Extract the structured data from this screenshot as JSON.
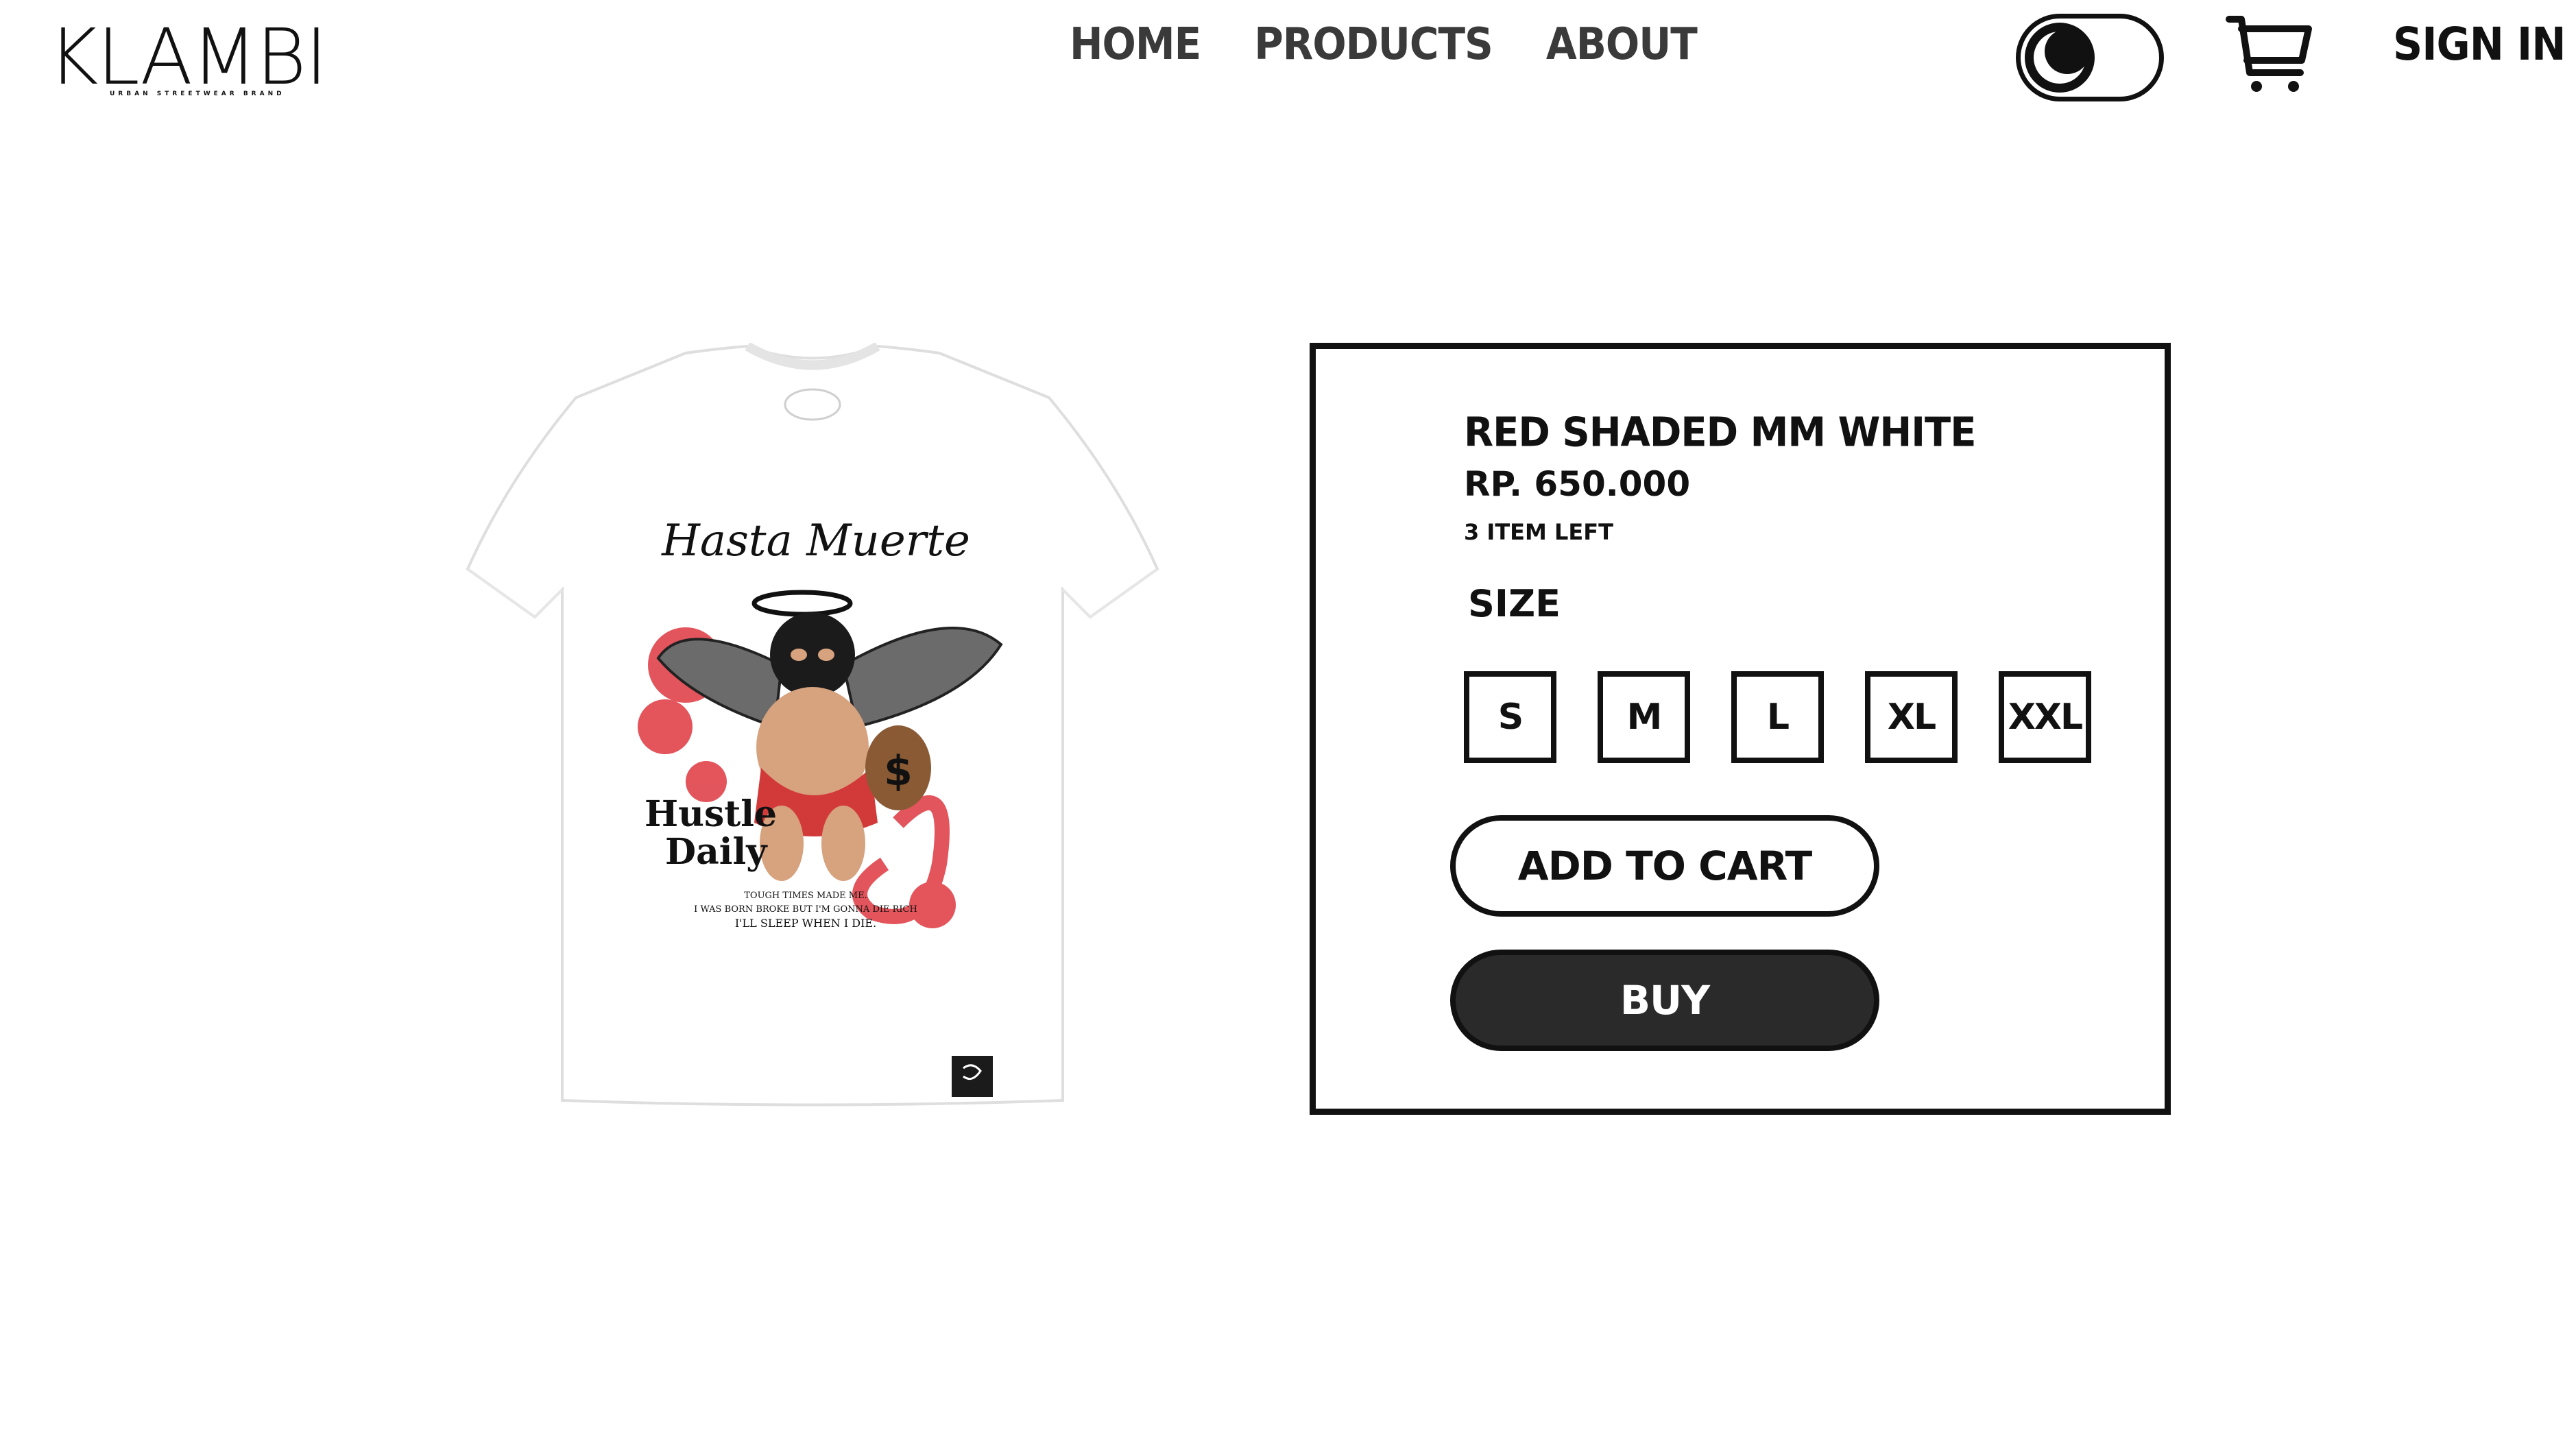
{
  "header": {
    "logo": {
      "text_main": "KLAMBI",
      "tagline": "URBAN STREETWEAR BRAND"
    },
    "nav": [
      {
        "label": "HOME"
      },
      {
        "label": "PRODUCTS"
      },
      {
        "label": "ABOUT"
      }
    ],
    "theme_toggle": {
      "icon": "moon-icon",
      "state": "dark-knob-left"
    },
    "cart": {
      "icon": "cart-icon"
    },
    "signin_label": "SIGN IN"
  },
  "product": {
    "image": {
      "shirt_color": "#ffffff",
      "print_title": "Hasta Muerte",
      "print_subtitle_1": "Hustle",
      "print_subtitle_2": "Daily",
      "print_line_1": "TOUGH TIMES MADE ME.",
      "print_line_2": "I WAS BORN BROKE BUT I'M GONNA DIE RICH",
      "print_line_3": "I'LL SLEEP WHEN I DIE.",
      "accent_color": "#e0424a"
    },
    "name": "RED SHADED MM WHITE",
    "price": "RP. 650.000",
    "stock": "3 ITEM LEFT",
    "size_label": "SIZE",
    "sizes": [
      "S",
      "M",
      "L",
      "XL",
      "XXL"
    ],
    "add_to_cart_label": "ADD TO CART",
    "buy_label": "BUY"
  },
  "colors": {
    "text": "#111111",
    "nav_text": "#3a3a3a",
    "buy_bg": "#2a2a2a",
    "logo_accent": "#1f7a78"
  }
}
